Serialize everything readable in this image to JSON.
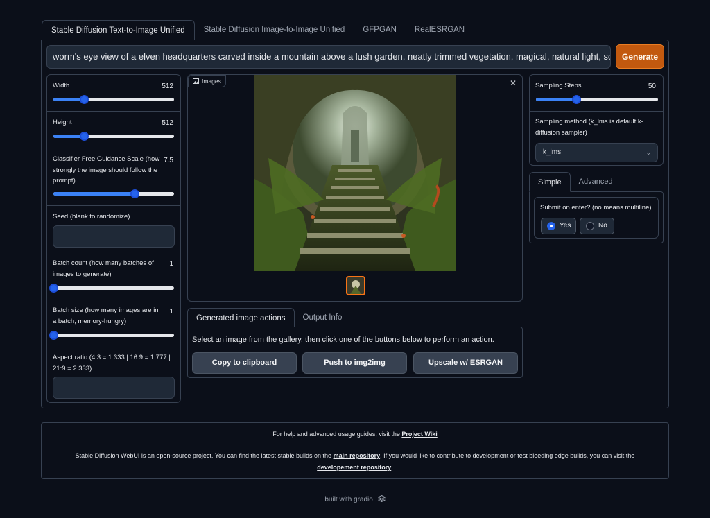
{
  "tabs": [
    {
      "label": "Stable Diffusion Text-to-Image Unified"
    },
    {
      "label": "Stable Diffusion Image-to-Image Unified"
    },
    {
      "label": "GFPGAN"
    },
    {
      "label": "RealESRGAN"
    }
  ],
  "prompt": {
    "value": "worm's eye view of a elven headquarters carved inside a mountain above a lush garden, neatly trimmed vegetation, magical, natural light, soft"
  },
  "generate_label": "Generate",
  "left_panel": {
    "width": {
      "label": "Width",
      "value": "512",
      "fraction": 0.25
    },
    "height": {
      "label": "Height",
      "value": "512",
      "fraction": 0.25
    },
    "cfg": {
      "label": "Classifier Free Guidance Scale (how strongly the image should follow the prompt)",
      "value": "7.5",
      "fraction": 0.67
    },
    "seed": {
      "label": "Seed (blank to randomize)",
      "value": ""
    },
    "batch_count": {
      "label": "Batch count (how many batches of images to generate)",
      "value": "1",
      "fraction": 0.0
    },
    "batch_size": {
      "label": "Batch size (how many images are in a batch; memory-hungry)",
      "value": "1",
      "fraction": 0.0
    },
    "aspect": {
      "label": "Aspect ratio (4:3 = 1.333 | 16:9 = 1.777 | 21:9 = 2.333)",
      "value": ""
    }
  },
  "gallery": {
    "label": "Images",
    "image_icon": "image-icon",
    "close_icon": "close-icon"
  },
  "action_tabs": [
    {
      "label": "Generated image actions"
    },
    {
      "label": "Output Info"
    }
  ],
  "actions": {
    "instruction": "Select an image from the gallery, then click one of the buttons below to perform an action.",
    "buttons": [
      {
        "label": "Copy to clipboard"
      },
      {
        "label": "Push to img2img"
      },
      {
        "label": "Upscale w/ ESRGAN"
      }
    ]
  },
  "right_panel": {
    "steps": {
      "label": "Sampling Steps",
      "value": "50",
      "fraction": 0.33
    },
    "method": {
      "label": "Sampling method (k_lms is default k-diffusion sampler)",
      "value": "k_lms"
    }
  },
  "mode_tabs": [
    {
      "label": "Simple"
    },
    {
      "label": "Advanced"
    }
  ],
  "submit": {
    "label": "Submit on enter? (no means multiline)",
    "options": [
      {
        "label": "Yes",
        "selected": true
      },
      {
        "label": "No",
        "selected": false
      }
    ]
  },
  "footer": {
    "line1_pre": "For help and advanced usage guides, visit the ",
    "line1_link": "Project Wiki",
    "line2_pre": "Stable Diffusion WebUI is an open-source project. You can find the latest stable builds on the ",
    "line2_link": "main repository",
    "line2_mid": ". If you would like to contribute to development or test bleeding edge builds, you can visit the",
    "line3_link": "developement repository",
    "line3_post": "."
  },
  "built_with": "built with gradio",
  "colors": {
    "accent": "#c2590f",
    "slider": "#3b82f6",
    "background": "#0b0f19"
  }
}
